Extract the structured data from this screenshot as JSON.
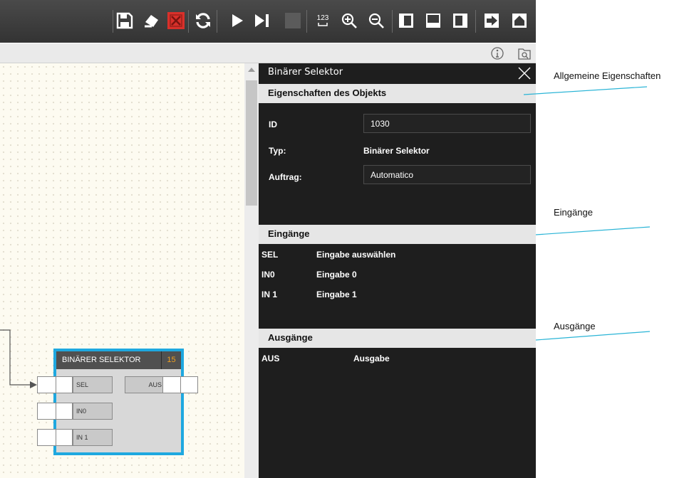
{
  "toolbar": {
    "icons": [
      "save-icon",
      "clear-icon",
      "delete-icon",
      "refresh-icon",
      "play-icon",
      "step-icon",
      "stop-icon",
      "numbering-icon",
      "zoom-in-icon",
      "zoom-out-icon",
      "left-panel-icon",
      "bottom-panel-icon",
      "right-panel-icon",
      "exit-icon",
      "home-icon"
    ],
    "number_label": "123"
  },
  "subbar": {
    "icons": [
      "info-icon",
      "search-folder-icon"
    ]
  },
  "panel": {
    "title": "Binärer Selektor",
    "properties_header": "Eigenschaften des Objekts",
    "properties": {
      "id_label": "ID",
      "id_value": "1030",
      "type_label": "Typ:",
      "type_value": "Binärer Selektor",
      "order_label": "Auftrag:",
      "order_value": "Automatico"
    },
    "inputs_header": "Eingänge",
    "inputs": [
      {
        "name": "SEL",
        "desc": "Eingabe auswählen"
      },
      {
        "name": "IN0",
        "desc": "Eingabe 0"
      },
      {
        "name": "IN 1",
        "desc": "Eingabe 1"
      }
    ],
    "outputs_header": "Ausgänge",
    "outputs": [
      {
        "name": "AUS",
        "desc": "Ausgabe"
      }
    ]
  },
  "annotations": {
    "general": "Allgemeine Eigenschaften",
    "inputs": "Eingänge",
    "outputs": "Ausgänge"
  },
  "block": {
    "title": "BINÄRER SELEKTOR",
    "number": "15",
    "inputs": [
      "SEL",
      "IN0",
      "IN 1"
    ],
    "output": "AUS"
  },
  "colors": {
    "accent": "#1ea8e0",
    "number": "#f0a020",
    "delete": "#d9302a",
    "callout_line": "#29b4d6"
  }
}
